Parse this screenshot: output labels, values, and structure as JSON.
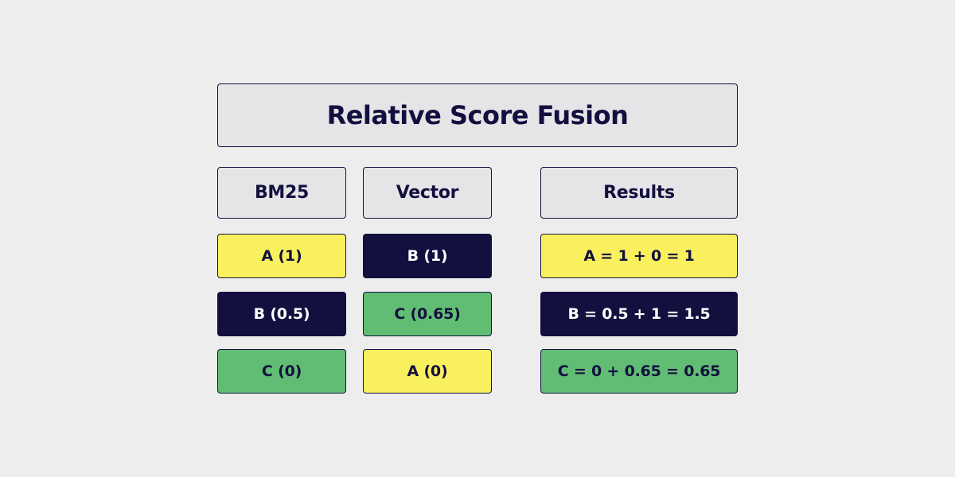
{
  "title": "Relative Score Fusion",
  "columns": {
    "bm25": {
      "header": "BM25",
      "items": [
        "A (1)",
        "B (0.5)",
        "C (0)"
      ]
    },
    "vector": {
      "header": "Vector",
      "items": [
        "B (1)",
        "C (0.65)",
        "A (0)"
      ]
    },
    "results": {
      "header": "Results",
      "items": [
        "A = 1 + 0 = 1",
        "B = 0.5 + 1 = 1.5",
        "C = 0 + 0.65 = 0.65"
      ]
    }
  },
  "colors": {
    "A": "#f9f05e",
    "B": "#13103f",
    "C": "#61bd73",
    "header_bg": "#e5e5e7",
    "border": "#13103f",
    "background": "#ededed"
  }
}
